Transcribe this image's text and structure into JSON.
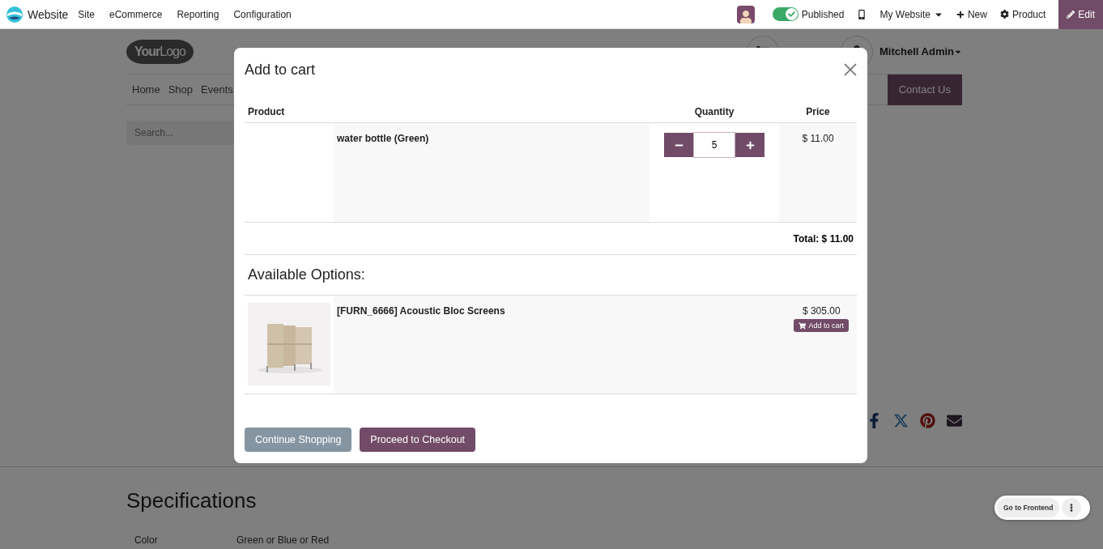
{
  "topbar": {
    "app": "Website",
    "menu": [
      "Site",
      "eCommerce",
      "Reporting",
      "Configuration"
    ],
    "published": {
      "label": "Published",
      "on": true
    },
    "website": "My Website",
    "new": "New",
    "product": "Product",
    "edit": "Edit"
  },
  "site": {
    "logo": "**Your**Logo",
    "user": "Mitchell Admin",
    "nav": [
      "Home",
      "Shop",
      "Events"
    ],
    "contact": "Contact Us",
    "search": {
      "placeholder": "Search..."
    },
    "specifications": {
      "title": "Specifications",
      "rows": [
        {
          "label": "Color",
          "value": "Green or Blue or Red"
        }
      ]
    }
  },
  "dialog": {
    "title": "Add to cart",
    "columns": [
      "Product",
      "Quantity",
      "Price"
    ],
    "item": {
      "name": "water bottle (Green)",
      "quantity": "5",
      "price": "$ 11.00"
    },
    "total": "Total: $ 11.00",
    "options_title": "Available Options:",
    "options": [
      {
        "name": "[FURN_6666] Acoustic Bloc Screens",
        "price": "$ 305.00",
        "button": "Add to cart"
      }
    ],
    "buttons": [
      "Continue Shopping",
      "Proceed to Checkout"
    ]
  },
  "frontend_button": "Go to Frontend"
}
